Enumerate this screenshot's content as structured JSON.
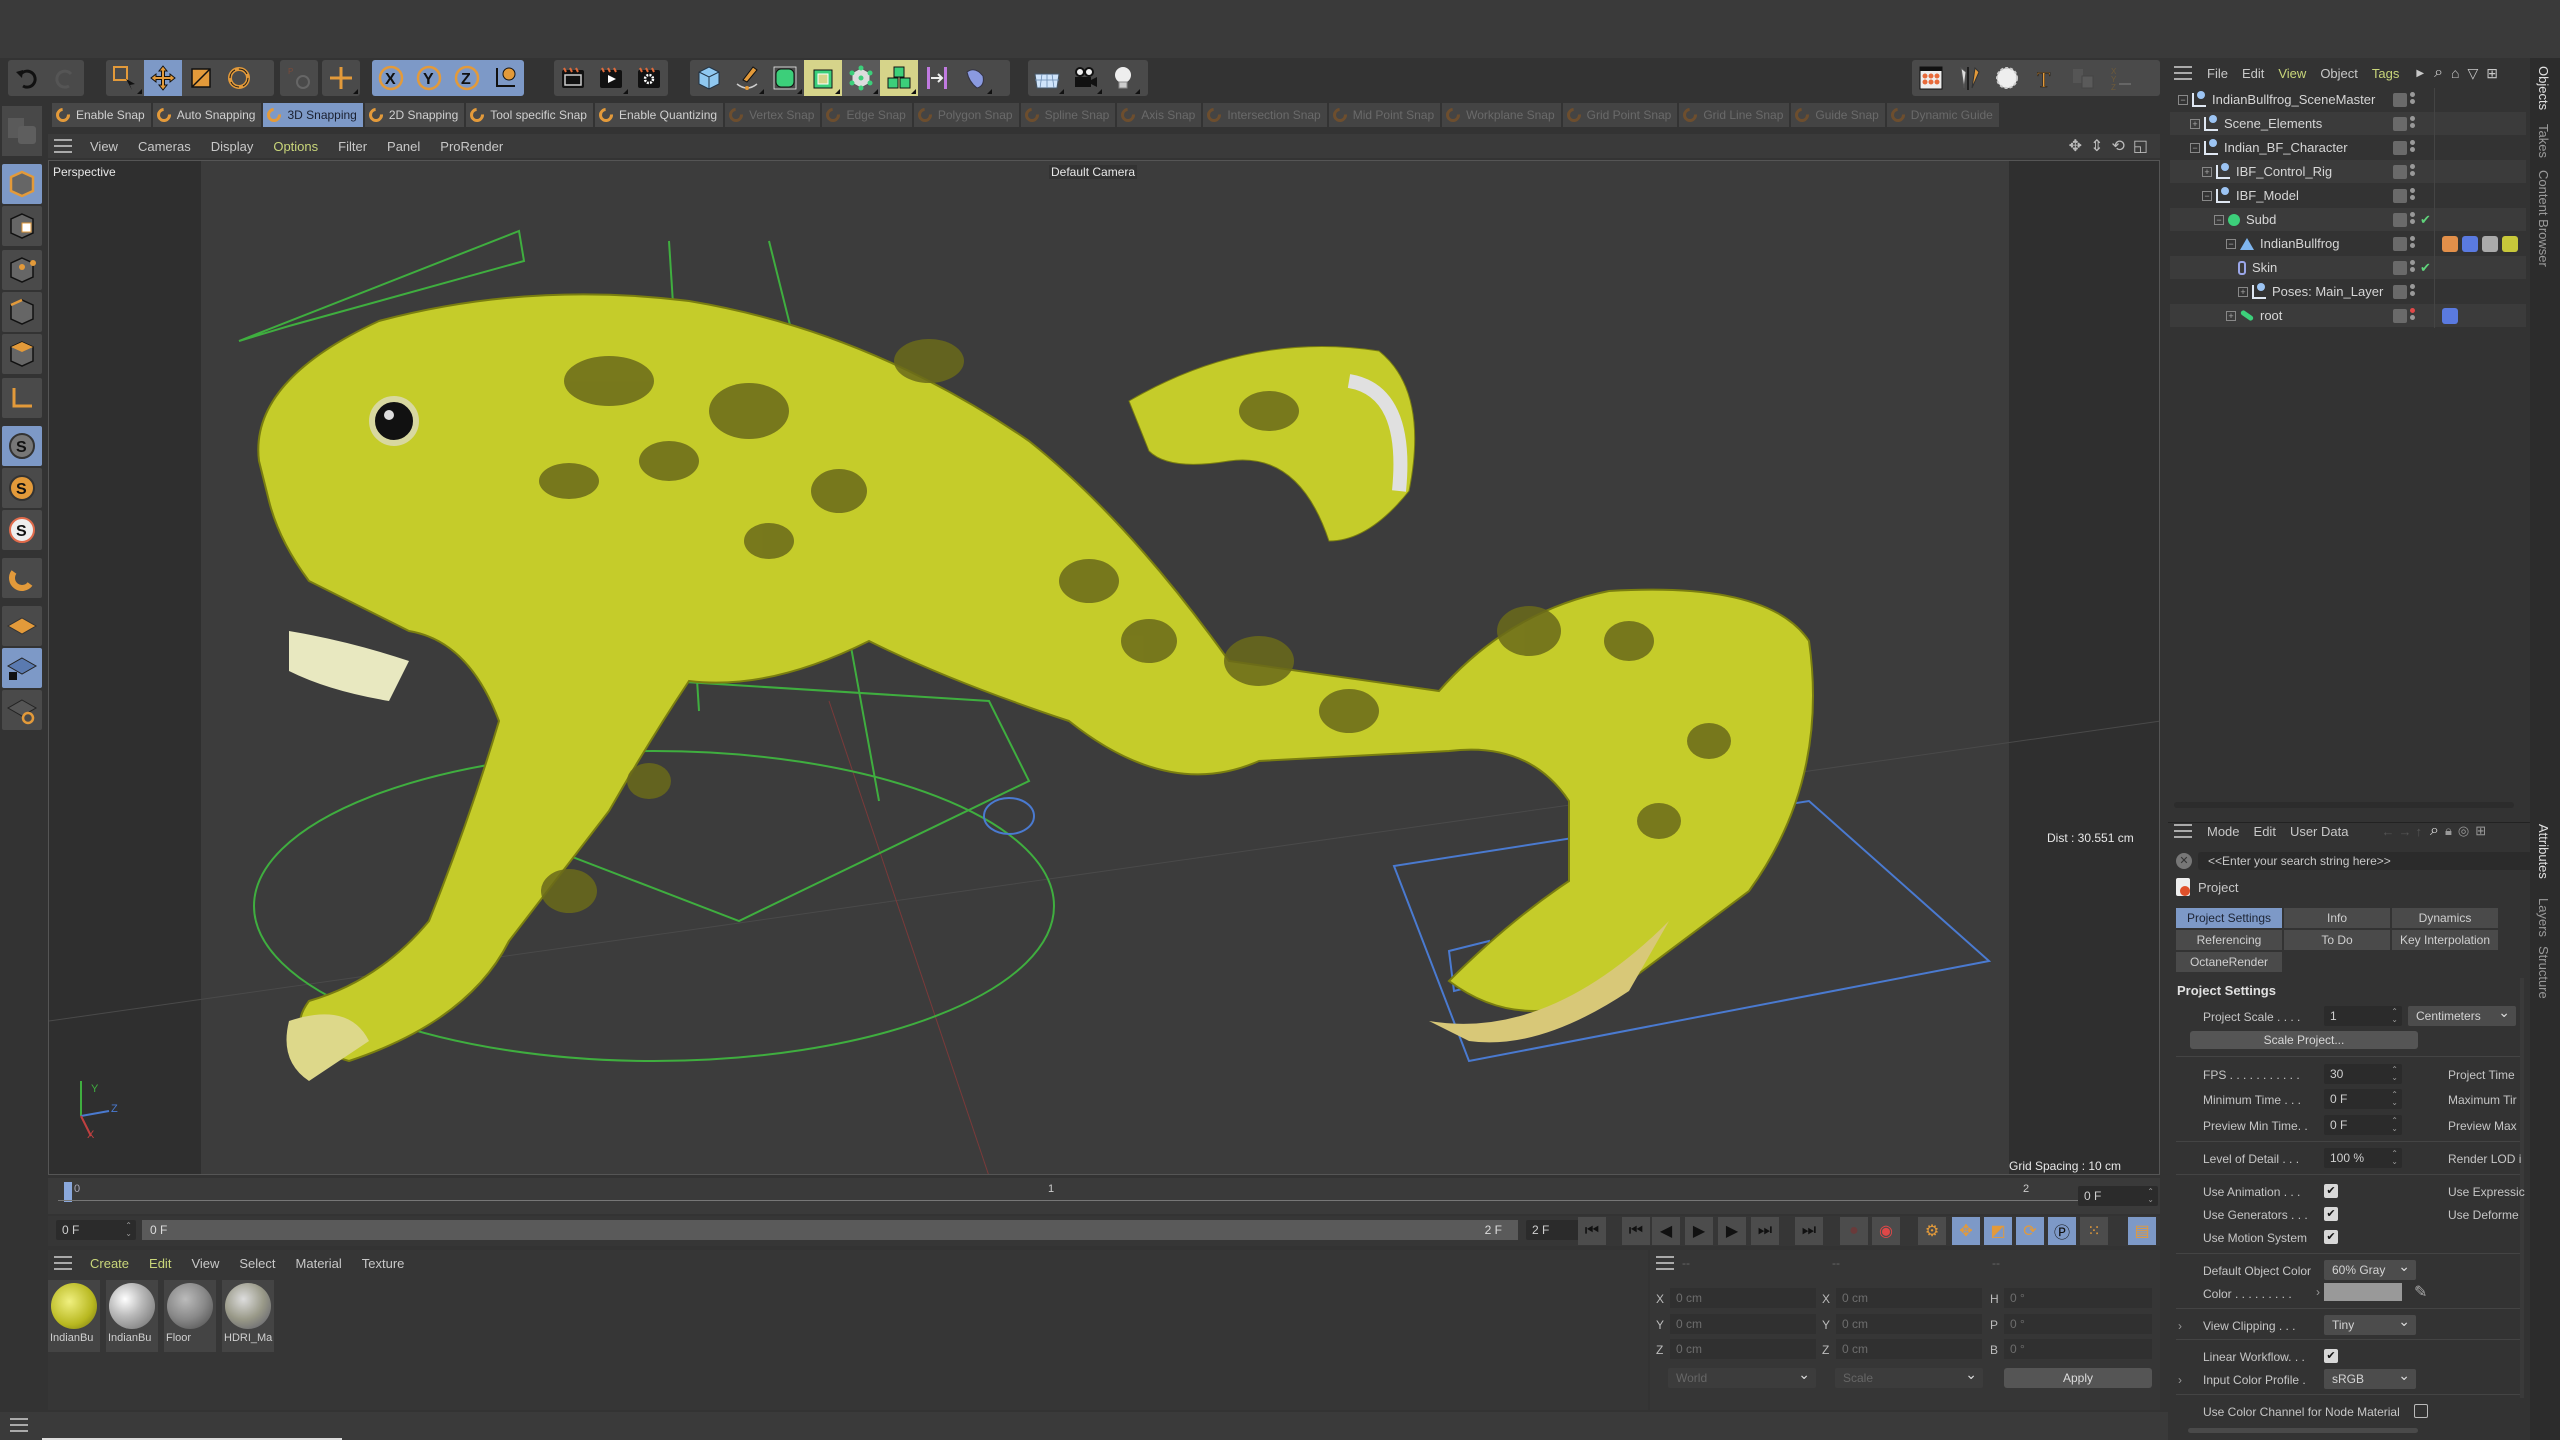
{
  "app": {
    "name": "Cinema 4D"
  },
  "main_toolbar": {
    "groups": [
      {
        "name": "history",
        "items": [
          "undo-icon",
          "redo-icon"
        ]
      },
      {
        "name": "tools",
        "items": [
          "live-selection-icon",
          "move-icon",
          "scale-icon",
          "rotate-icon"
        ]
      },
      {
        "name": "psr",
        "items": [
          "psr-reset-icon"
        ]
      },
      {
        "name": "recent",
        "items": [
          "move-tool-recent-icon"
        ]
      },
      {
        "name": "axis-lock",
        "items": [
          "x-axis-icon",
          "y-axis-icon",
          "z-axis-icon",
          "coordinate-system-icon"
        ]
      },
      {
        "name": "render",
        "items": [
          "render-view-icon",
          "render-to-picture-viewer-icon",
          "render-settings-icon"
        ]
      },
      {
        "name": "objects",
        "items": [
          "cube-icon",
          "pen-icon",
          "subdivision-icon",
          "extrude-icon",
          "generator-icon",
          "cloner-icon",
          "bend-deformer-icon",
          "field-icon"
        ]
      },
      {
        "name": "scene",
        "items": [
          "floor-icon",
          "camera-icon",
          "light-icon"
        ]
      },
      {
        "name": "right",
        "items": [
          "mograph-icon",
          "sculpt-icon",
          "spline-icon",
          "text-icon",
          "convert-icon",
          "xyz-icon"
        ]
      }
    ]
  },
  "snap_bar": [
    {
      "label": "Enable Snap",
      "state": "normal"
    },
    {
      "label": "Auto Snapping",
      "state": "normal"
    },
    {
      "label": "3D Snapping",
      "state": "active"
    },
    {
      "label": "2D Snapping",
      "state": "normal"
    },
    {
      "label": "Tool specific Snap",
      "state": "normal"
    },
    {
      "label": "Enable Quantizing",
      "state": "normal"
    },
    {
      "label": "Vertex Snap",
      "state": "disabled"
    },
    {
      "label": "Edge Snap",
      "state": "disabled"
    },
    {
      "label": "Polygon Snap",
      "state": "disabled"
    },
    {
      "label": "Spline Snap",
      "state": "disabled"
    },
    {
      "label": "Axis Snap",
      "state": "disabled"
    },
    {
      "label": "Intersection Snap",
      "state": "disabled"
    },
    {
      "label": "Mid Point Snap",
      "state": "disabled"
    },
    {
      "label": "Workplane Snap",
      "state": "disabled"
    },
    {
      "label": "Grid Point Snap",
      "state": "disabled"
    },
    {
      "label": "Grid Line Snap",
      "state": "disabled"
    },
    {
      "label": "Guide Snap",
      "state": "disabled"
    },
    {
      "label": "Dynamic Guide",
      "state": "disabled"
    }
  ],
  "viewport": {
    "menu": [
      "View",
      "Cameras",
      "Display",
      "Options",
      "Filter",
      "Panel",
      "ProRender"
    ],
    "active_menu": "Options",
    "view_name": "Perspective",
    "camera": "Default Camera",
    "dist": "Dist : 30.551 cm",
    "grid_spacing": "Grid Spacing : 10 cm",
    "axis_labels": [
      "Y",
      "Z",
      "X"
    ]
  },
  "timeline": {
    "ticks": [
      "0",
      "1",
      "2"
    ],
    "current_frame_field": "0 F",
    "range_start": "0 F",
    "range_end_label": "2 F",
    "end_field": "2 F",
    "right_field": "0 F"
  },
  "material_manager": {
    "menu": [
      "Create",
      "Edit",
      "View",
      "Select",
      "Material",
      "Texture"
    ],
    "materials": [
      {
        "name": "IndianBu",
        "color": "#c8c83a"
      },
      {
        "name": "IndianBu",
        "color": "#d8d8d8"
      },
      {
        "name": "Floor",
        "color": "#8a8a8a"
      },
      {
        "name": "HDRI_Ma",
        "color": "#b0a898"
      }
    ]
  },
  "coordinates": {
    "headers": [
      "--",
      "--",
      "--"
    ],
    "position": [
      {
        "axis": "X",
        "value": "0 cm"
      },
      {
        "axis": "Y",
        "value": "0 cm"
      },
      {
        "axis": "Z",
        "value": "0 cm"
      }
    ],
    "size": [
      {
        "axis": "X",
        "value": "0 cm"
      },
      {
        "axis": "Y",
        "value": "0 cm"
      },
      {
        "axis": "Z",
        "value": "0 cm"
      }
    ],
    "rotation": [
      {
        "axis": "H",
        "value": "0 °"
      },
      {
        "axis": "P",
        "value": "0 °"
      },
      {
        "axis": "B",
        "value": "0 °"
      }
    ],
    "mode_dropdown": "World",
    "scale_dropdown": "Scale",
    "apply_label": "Apply"
  },
  "object_manager": {
    "menu": [
      "File",
      "Edit",
      "View",
      "Object",
      "Tags"
    ],
    "highlighted_menu": [
      "View",
      "Tags"
    ],
    "objects": [
      {
        "name": "IndianBullfrog_SceneMaster",
        "depth": 0,
        "icon": "null-icon",
        "expander": "-",
        "check": false
      },
      {
        "name": "Scene_Elements",
        "depth": 1,
        "icon": "null-icon",
        "expander": "+",
        "check": false
      },
      {
        "name": "Indian_BF_Character",
        "depth": 1,
        "icon": "null-icon",
        "expander": "-",
        "check": false
      },
      {
        "name": "IBF_Control_Rig",
        "depth": 2,
        "icon": "null-icon",
        "expander": "+",
        "check": false
      },
      {
        "name": "IBF_Model",
        "depth": 2,
        "icon": "null-icon",
        "expander": "-",
        "check": false
      },
      {
        "name": "Subd",
        "depth": 3,
        "icon": "subdivision-surface-icon",
        "expander": "-",
        "check": true
      },
      {
        "name": "IndianBullfrog",
        "depth": 4,
        "icon": "polygon-object-icon",
        "expander": "-",
        "check": false
      },
      {
        "name": "Skin",
        "depth": 5,
        "icon": "skin-deformer-icon",
        "expander": "",
        "check": true
      },
      {
        "name": "Poses: Main_Layer",
        "depth": 5,
        "icon": "null-icon",
        "expander": "+",
        "check": false
      },
      {
        "name": "root",
        "depth": 4,
        "icon": "joint-icon",
        "expander": "+",
        "check": false
      }
    ],
    "side_tabs": [
      "Objects",
      "Takes",
      "Content Browser"
    ]
  },
  "attributes": {
    "menu": [
      "Mode",
      "Edit",
      "User Data"
    ],
    "search_placeholder": "<<Enter your search string here>>",
    "object_type": "Project",
    "tabs": [
      {
        "label": "Project Settings",
        "active": true
      },
      {
        "label": "Info",
        "active": false
      },
      {
        "label": "Dynamics",
        "active": false
      },
      {
        "label": "Referencing",
        "active": false
      },
      {
        "label": "To Do",
        "active": false
      },
      {
        "label": "Key Interpolation",
        "active": false
      },
      {
        "label": "OctaneRender",
        "active": false
      }
    ],
    "section_title": "Project Settings",
    "project_scale": {
      "label": "Project Scale . . . .",
      "value": "1",
      "unit": "Centimeters"
    },
    "scale_project_button": "Scale Project...",
    "fps": {
      "label": "FPS . . . . . . . . . . .",
      "value": "30"
    },
    "min_time": {
      "label": "Minimum Time . . .",
      "value": "0 F"
    },
    "preview_min": {
      "label": "Preview Min Time. .",
      "value": "0 F"
    },
    "lod": {
      "label": "Level of Detail . . .",
      "value": "100 %"
    },
    "right_labels": [
      "Project Time",
      "Maximum Tir",
      "Preview Max",
      "Render LOD i",
      "Use Expressic",
      "Use Deforme"
    ],
    "use_animation": {
      "label": "Use Animation . . .",
      "checked": true
    },
    "use_generators": {
      "label": "Use Generators . . .",
      "checked": true
    },
    "use_motion": {
      "label": "Use Motion System",
      "checked": true
    },
    "default_color": {
      "label": "Default Object Color",
      "value": "60% Gray"
    },
    "color": {
      "label": "Color . . . . . . . . .",
      "swatch": "#999999"
    },
    "view_clipping": {
      "label": "View Clipping . . .",
      "value": "Tiny"
    },
    "linear_workflow": {
      "label": "Linear Workflow. . .",
      "checked": true
    },
    "input_profile": {
      "label": "Input Color Profile .",
      "value": "sRGB"
    },
    "node_material": {
      "label": "Use Color Channel for Node Material",
      "checked": false
    },
    "side_tabs": [
      "Attributes",
      "Layers",
      "Structure"
    ]
  },
  "colors": {
    "accent": "#7d99c7",
    "highlight_menu": "#c9d67a",
    "orange": "#e39a3a",
    "frog": "#c5cc2a"
  }
}
